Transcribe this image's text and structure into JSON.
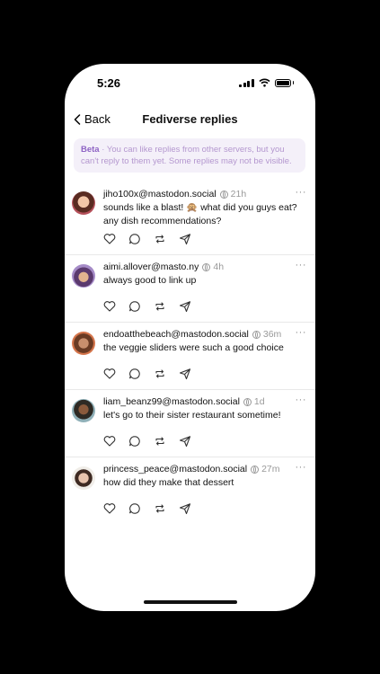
{
  "status_bar": {
    "time": "5:26"
  },
  "nav": {
    "back_label": "Back",
    "title": "Fediverse replies"
  },
  "banner": {
    "label": "Beta",
    "text": " · You can like replies from other servers, but you can't reply to them yet. Some replies may not be visible."
  },
  "replies": [
    {
      "handle": "jiho100x@mastodon.social",
      "time": "21h",
      "text": "sounds like a blast! 🙊 what did you guys eat? any dish recommendations?"
    },
    {
      "handle": "aimi.allover@masto.ny",
      "time": "4h",
      "text": "always good to link up"
    },
    {
      "handle": "endoatthebeach@mastodon.social",
      "time": "36m",
      "text": "the veggie sliders were such a good choice"
    },
    {
      "handle": "liam_beanz99@mastodon.social",
      "time": "1d",
      "text": "let's go to their sister restaurant sometime!"
    },
    {
      "handle": "princess_peace@mastodon.social",
      "time": "27m",
      "text": "how did they make that dessert"
    }
  ],
  "more_glyph": "···",
  "colors": {
    "accent": "#8e63c4",
    "banner_bg": "#f4f0f9",
    "divider": "#e8e8e8"
  },
  "icons": [
    "back-chevron-icon",
    "globe-icon",
    "heart-icon",
    "comment-icon",
    "repost-icon",
    "share-icon",
    "more-icon"
  ]
}
